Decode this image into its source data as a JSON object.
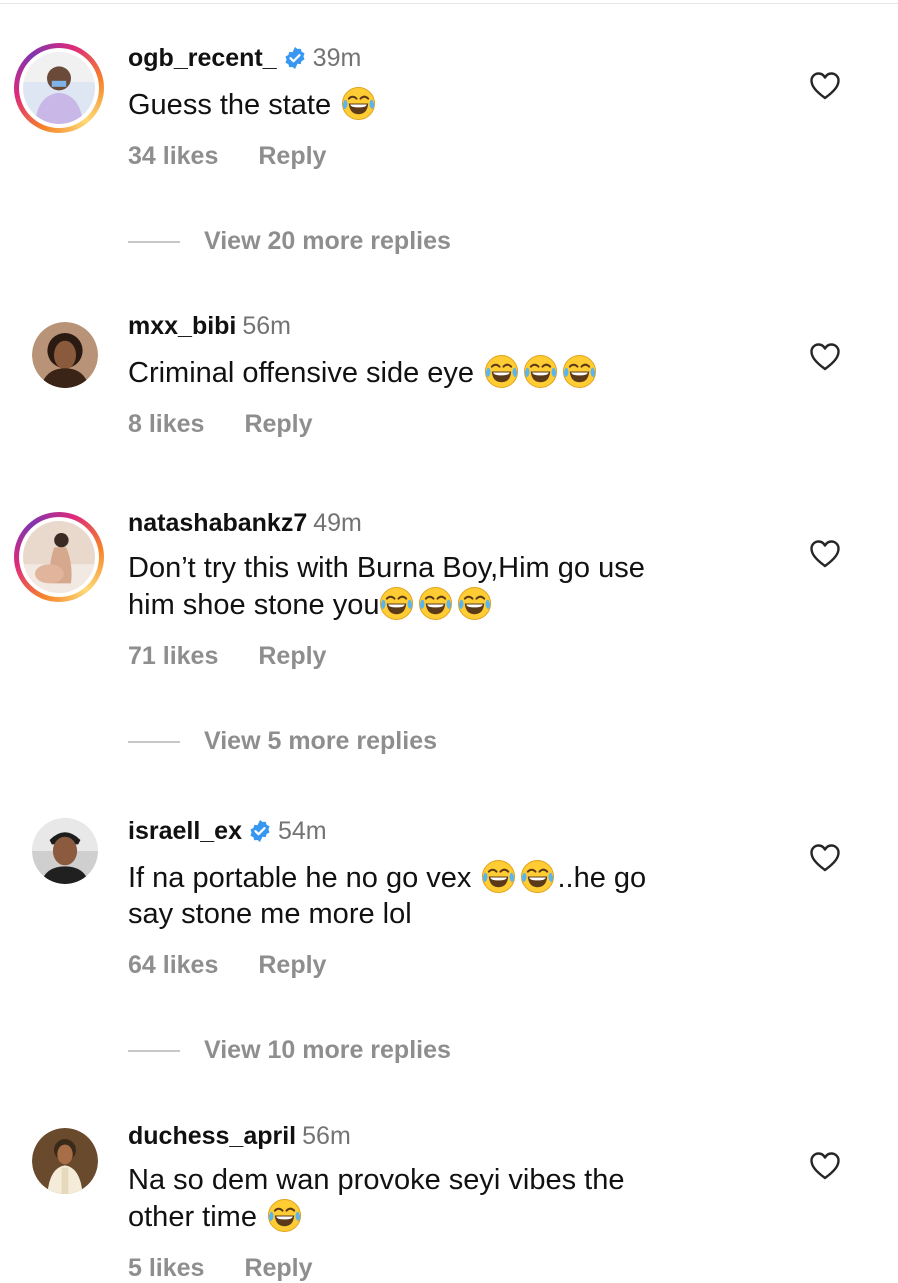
{
  "comments": [
    {
      "username": "ogb_recent_",
      "verified": true,
      "time": "39m",
      "text": "Guess the state",
      "emojis": 1,
      "likes": "34 likes",
      "reply": "Reply",
      "more_replies": "View 20 more replies",
      "has_story_ring": true
    },
    {
      "username": "mxx_bibi",
      "verified": false,
      "time": "56m",
      "text": "Criminal offensive side eye",
      "emojis": 3,
      "likes": "8 likes",
      "reply": "Reply",
      "has_story_ring": false
    },
    {
      "username": "natashabankz7",
      "verified": false,
      "time": "49m",
      "text_line1": "Don’t try this with Burna Boy,Him go use",
      "text_line2": "him shoe stone you",
      "emojis": 3,
      "likes": "71 likes",
      "reply": "Reply",
      "more_replies": "View 5 more replies",
      "has_story_ring": true
    },
    {
      "username": "israell_ex",
      "verified": true,
      "time": "54m",
      "text_part1": "If na portable he no go vex",
      "text_part2": "..he go",
      "text_line2": "say stone me more lol",
      "emojis": 2,
      "likes": "64 likes",
      "reply": "Reply",
      "more_replies": "View 10 more replies",
      "has_story_ring": false
    },
    {
      "username": "duchess_april",
      "verified": false,
      "time": "56m",
      "text_line1": "Na so dem wan provoke seyi vibes the",
      "text_line2": "other time",
      "emojis": 1,
      "likes": "5 likes",
      "reply": "Reply",
      "has_story_ring": false
    }
  ],
  "icons": {
    "heart": "heart-outline-icon",
    "verified": "verified-badge-icon",
    "emoji": "face-with-tears-of-joy-emoji"
  },
  "colors": {
    "verified_blue": "#3897f0",
    "secondary_text": "#737373",
    "emoji_yellow": "#ffcc33"
  }
}
